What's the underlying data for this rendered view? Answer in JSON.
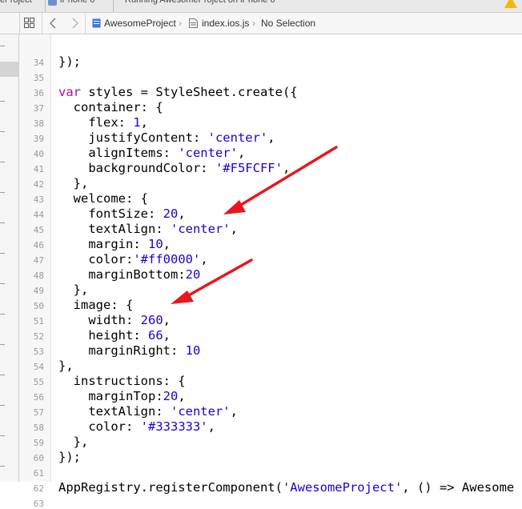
{
  "window": {
    "tab_left": "er roject",
    "tab_device": "iPhone 6",
    "tab_running": "Running AwesomeProject on iPhone 6"
  },
  "jumpbar": {
    "project": "AwesomeProject",
    "file": "index.ios.js",
    "selection": "No Selection"
  },
  "editor": {
    "lines": [
      {
        "n": "34",
        "text": "});"
      },
      {
        "n": "35",
        "text": ""
      },
      {
        "n": "36",
        "text": "var styles = StyleSheet.create({"
      },
      {
        "n": "37",
        "text": "  container: {"
      },
      {
        "n": "38",
        "text": "    flex: 1,"
      },
      {
        "n": "39",
        "text": "    justifyContent: 'center',"
      },
      {
        "n": "40",
        "text": "    alignItems: 'center',"
      },
      {
        "n": "41",
        "text": "    backgroundColor: '#F5FCFF',"
      },
      {
        "n": "42",
        "text": "  },"
      },
      {
        "n": "43",
        "text": "  welcome: {"
      },
      {
        "n": "44",
        "text": "    fontSize: 20,"
      },
      {
        "n": "45",
        "text": "    textAlign: 'center',"
      },
      {
        "n": "46",
        "text": "    margin: 10,"
      },
      {
        "n": "47",
        "text": "    color:'#ff0000',"
      },
      {
        "n": "48",
        "text": "    marginBottom:20"
      },
      {
        "n": "49",
        "text": "  },"
      },
      {
        "n": "50",
        "text": "  image: {"
      },
      {
        "n": "51",
        "text": "    width: 260,"
      },
      {
        "n": "52",
        "text": "    height: 66,"
      },
      {
        "n": "53",
        "text": "    marginRight: 10"
      },
      {
        "n": "54",
        "text": "},"
      },
      {
        "n": "55",
        "text": "  instructions: {"
      },
      {
        "n": "56",
        "text": "    marginTop:20,"
      },
      {
        "n": "57",
        "text": "    textAlign: 'center',"
      },
      {
        "n": "58",
        "text": "    color: '#333333',"
      },
      {
        "n": "59",
        "text": "  },"
      },
      {
        "n": "60",
        "text": "});"
      },
      {
        "n": "61",
        "text": ""
      },
      {
        "n": "62",
        "text": "AppRegistry.registerComponent('AwesomeProject', () => Awesome"
      },
      {
        "n": "63",
        "text": ""
      }
    ]
  },
  "colors": {
    "string": "#1c00cf",
    "number": "#1c00cf",
    "keyword": "#aa0d91",
    "arrow": "#e8161c"
  },
  "icons": [
    "grid-icon",
    "back-chevron-icon",
    "forward-chevron-icon",
    "project-file-icon",
    "js-file-icon",
    "warning-icon"
  ]
}
